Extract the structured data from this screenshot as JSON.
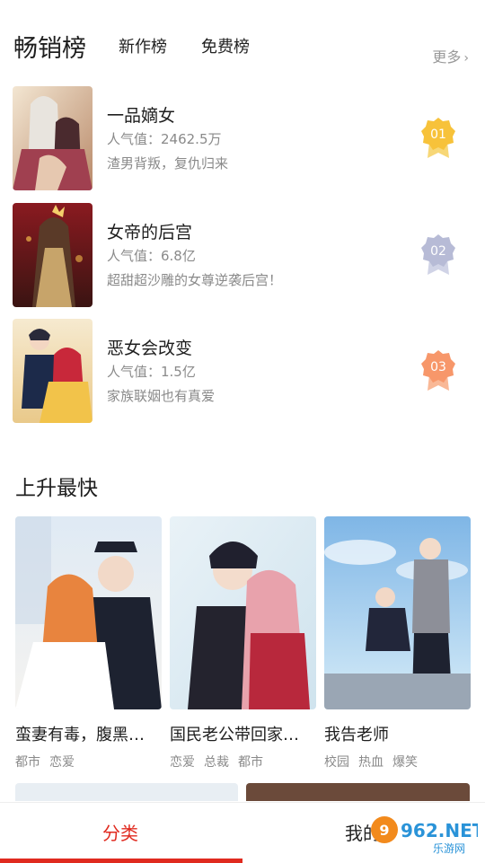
{
  "header": {
    "tab_bestseller": "畅销榜",
    "tab_new": "新作榜",
    "tab_free": "免费榜",
    "more_label": "更多"
  },
  "ranking": [
    {
      "rank": "01",
      "title": "一品嫡女",
      "popularity": "人气值：2462.5万",
      "desc": "渣男背叛，复仇归来",
      "medal_color": "#f7c23a"
    },
    {
      "rank": "02",
      "title": "女帝的后宫",
      "popularity": "人气值：6.8亿",
      "desc": "超甜超沙雕的女尊逆袭后宫！",
      "medal_color": "#b7bbd6"
    },
    {
      "rank": "03",
      "title": "恶女会改变",
      "popularity": "人气值：1.5亿",
      "desc": "家族联姻也有真爱",
      "medal_color": "#f7976a"
    }
  ],
  "rising": {
    "title": "上升最快",
    "items": [
      {
        "title": "蛮妻有毒，腹黑…",
        "tags": [
          "都市",
          "恋爱"
        ]
      },
      {
        "title": "国民老公带回家…",
        "tags": [
          "恋爱",
          "总裁",
          "都市"
        ]
      },
      {
        "title": "我告老师",
        "tags": [
          "校园",
          "热血",
          "爆笑"
        ]
      }
    ]
  },
  "bottom_nav": {
    "category_label": "分类",
    "mine_label": "我的",
    "accent": "#e02a1f"
  },
  "watermark": {
    "brand": "962.NET",
    "sub": "乐游网"
  }
}
